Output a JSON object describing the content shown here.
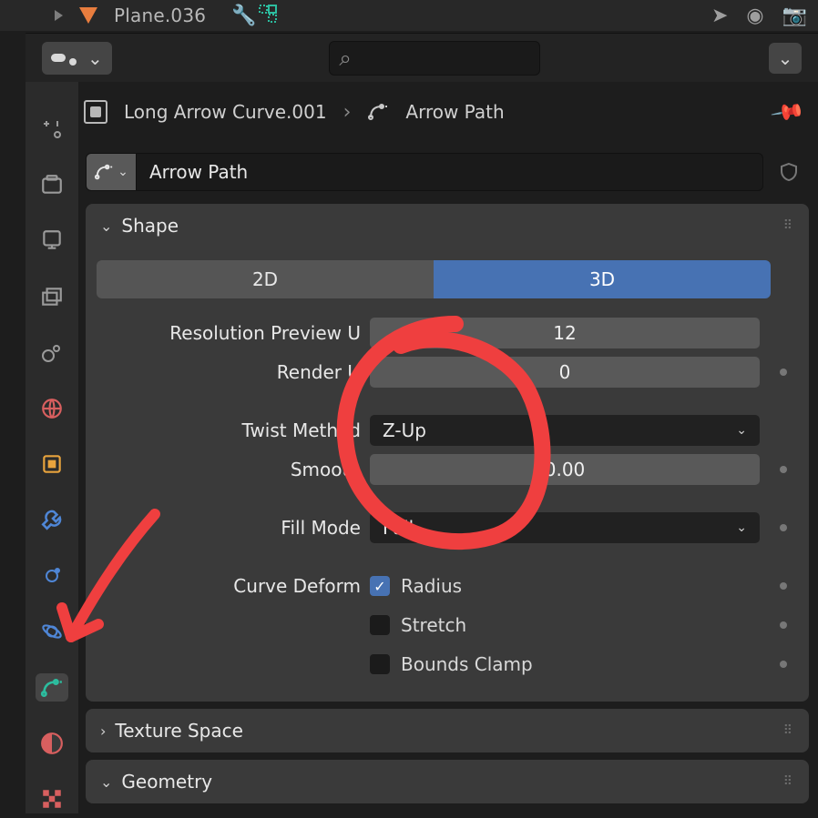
{
  "outliner": {
    "object_name": "Plane.036"
  },
  "breadcrumb": {
    "object": "Long Arrow Curve.001",
    "data": "Arrow Path"
  },
  "datablock": {
    "name": "Arrow Path"
  },
  "panels": {
    "shape": {
      "title": "Shape",
      "mode": {
        "opt_a": "2D",
        "opt_b": "3D",
        "selected": "3D"
      },
      "resolution_preview_label": "Resolution Preview U",
      "resolution_preview_value": "12",
      "render_u_label": "Render U",
      "render_u_value": "0",
      "twist_method_label": "Twist Method",
      "twist_method_value": "Z-Up",
      "smooth_label": "Smooth",
      "smooth_value": "0.00",
      "fill_mode_label": "Fill Mode",
      "fill_mode_value": "Full",
      "curve_deform_label": "Curve Deform",
      "radius_label": "Radius",
      "stretch_label": "Stretch",
      "bounds_clamp_label": "Bounds Clamp"
    },
    "texture_space": {
      "title": "Texture Space"
    },
    "geometry": {
      "title": "Geometry"
    }
  },
  "glyphs": {
    "chevron_down": "⌄",
    "chevron_right": "›",
    "search": "⌕",
    "pin": "📌",
    "check": "✓",
    "wrench": "🔧",
    "camera": "📷",
    "eye": "👁",
    "cursor": "➤",
    "drag": "⠿"
  }
}
